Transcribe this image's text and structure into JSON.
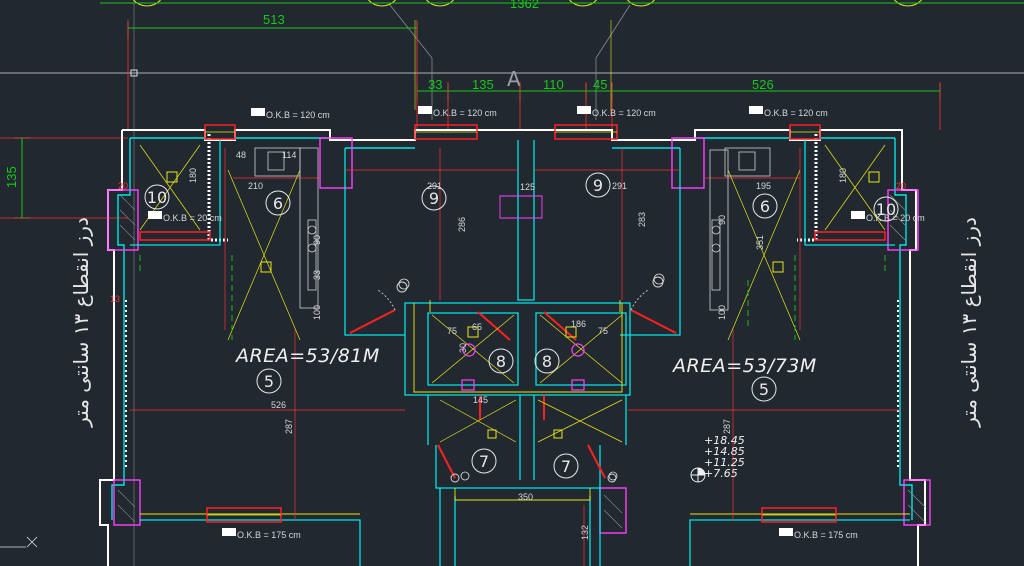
{
  "drawing": {
    "colors": {
      "background": "#212830",
      "wall_outer": "#ffffff",
      "wall_inner": "#00e5e5",
      "dimension": "#19c819",
      "window": "#ff2020",
      "grid_line": "#b0b0b0",
      "furniture": "#e6e619",
      "fixture": "#ff40ff"
    },
    "grid_axis_label": "A",
    "top_dimensions": {
      "overall": "1362",
      "left_span": "513",
      "segments": [
        "33",
        "135",
        "110",
        "45",
        "526"
      ]
    },
    "left_dimension": "135",
    "side_notes": {
      "left": "درز انقطاع ۱۳ سانتی متر",
      "right": "درز انقطاع ۱۳ سانتی متر"
    },
    "areas": {
      "left_unit": "AREA=53/81M",
      "right_unit": "AREA=53/73M"
    },
    "room_numbers": {
      "r10_left": "10",
      "r6_left": "6",
      "r9_left": "9",
      "r9_right": "9",
      "r6_right": "6",
      "r10_right": "10",
      "r5_left": "5",
      "r5_right": "5",
      "r8_left": "8",
      "r8_right": "8",
      "r7_left": "7",
      "r7_right": "7"
    },
    "window_tags": {
      "w1": "O.K.B = 120 cm",
      "w2": "O.K.B = 120 cm",
      "w3": "O.K.B = 120 cm",
      "w4": "O.K.B = 120 cm",
      "w5": "O.K.B = 20 cm",
      "w6": "O.K.B = 20 cm",
      "w7": "O.K.B = 175 cm",
      "w8": "O.K.B = 175 cm"
    },
    "room_dims": {
      "d210": "210",
      "d195": "195",
      "d291a": "291",
      "d291b": "291",
      "d286": "286",
      "d283": "283",
      "d526": "526",
      "d287a": "287",
      "d287b": "287",
      "d180a": "180",
      "d180b": "180",
      "d48": "48",
      "d114": "114",
      "d20a": "20",
      "d20b": "20",
      "d75a": "75",
      "d75b": "75",
      "d65": "65",
      "d186": "186",
      "d145": "145",
      "d350": "350",
      "d132": "132",
      "d125": "125",
      "d100a": "100",
      "d100b": "100",
      "d90a": "90",
      "d90b": "90",
      "d33a": "33",
      "d351": "351",
      "d13": "13",
      "d30": "30"
    },
    "levels": [
      "+18.45",
      "+14.85",
      "+11.25",
      "+7.65"
    ]
  }
}
